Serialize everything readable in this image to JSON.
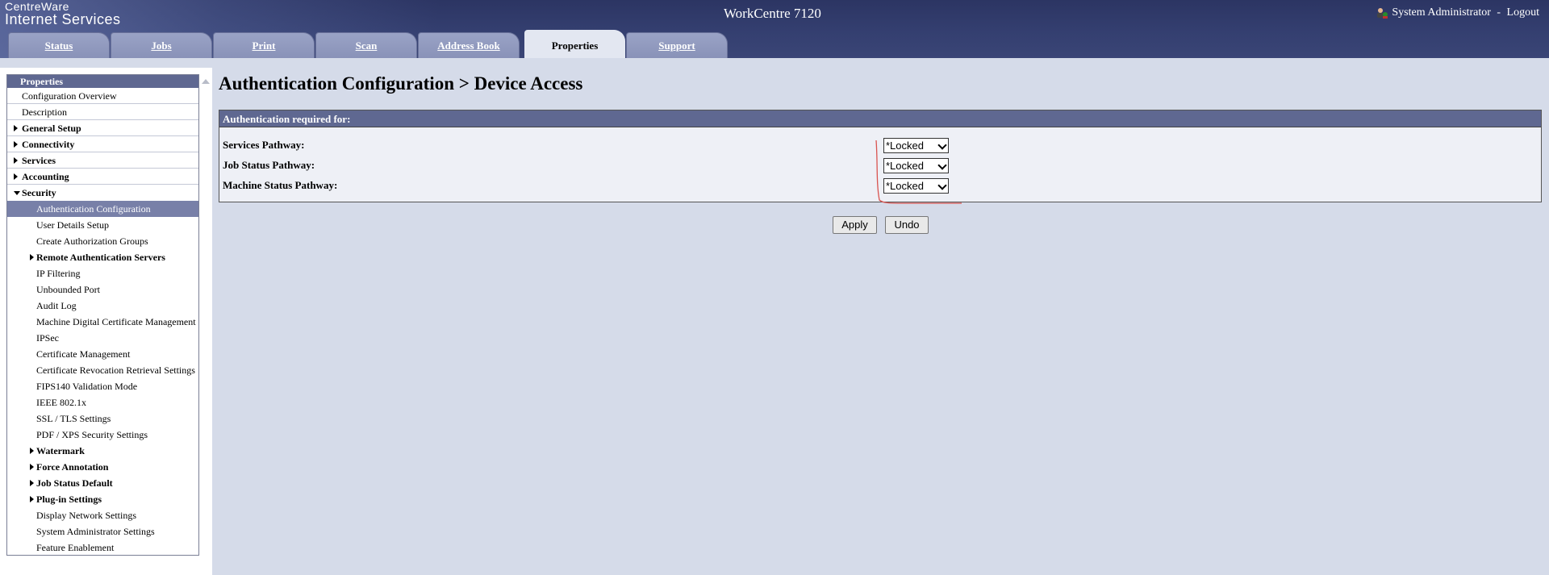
{
  "header": {
    "logo_line1": "CentreWare",
    "logo_line2": "Internet Services",
    "device_name": "WorkCentre 7120",
    "user_name": "System Administrator",
    "separator": " - ",
    "logout": "Logout"
  },
  "tabs": [
    {
      "label": "Status",
      "active": false
    },
    {
      "label": "Jobs",
      "active": false
    },
    {
      "label": "Print",
      "active": false
    },
    {
      "label": "Scan",
      "active": false
    },
    {
      "label": "Address Book",
      "active": false
    },
    {
      "label": "Properties",
      "active": true
    },
    {
      "label": "Support",
      "active": false
    }
  ],
  "sidebar": {
    "header": "Properties",
    "items": [
      {
        "label": "Configuration Overview"
      },
      {
        "label": "Description"
      },
      {
        "label": "General Setup"
      },
      {
        "label": "Connectivity"
      },
      {
        "label": "Services"
      },
      {
        "label": "Accounting"
      },
      {
        "label": "Security"
      },
      {
        "label": "Authentication Configuration"
      },
      {
        "label": "User Details Setup"
      },
      {
        "label": "Create Authorization Groups"
      },
      {
        "label": "Remote Authentication Servers"
      },
      {
        "label": "IP Filtering"
      },
      {
        "label": "Unbounded Port"
      },
      {
        "label": "Audit Log"
      },
      {
        "label": "Machine Digital Certificate Management"
      },
      {
        "label": "IPSec"
      },
      {
        "label": "Certificate Management"
      },
      {
        "label": "Certificate Revocation Retrieval Settings"
      },
      {
        "label": "FIPS140 Validation Mode"
      },
      {
        "label": "IEEE 802.1x"
      },
      {
        "label": "SSL / TLS Settings"
      },
      {
        "label": "PDF / XPS Security Settings"
      },
      {
        "label": "Watermark"
      },
      {
        "label": "Force Annotation"
      },
      {
        "label": "Job Status Default"
      },
      {
        "label": "Plug-in Settings"
      },
      {
        "label": "Display Network Settings"
      },
      {
        "label": "System Administrator Settings"
      },
      {
        "label": "Feature Enablement"
      }
    ]
  },
  "main": {
    "title": "Authentication Configuration > Device Access",
    "panel_header": "Authentication required for:",
    "rows": [
      {
        "label": "Services Pathway:",
        "value": "*Locked"
      },
      {
        "label": "Job Status Pathway:",
        "value": "*Locked"
      },
      {
        "label": "Machine Status Pathway:",
        "value": "*Locked"
      }
    ],
    "apply_label": "Apply",
    "undo_label": "Undo"
  },
  "colors": {
    "header_bg": "#2c3563",
    "panel_header_bg": "#5f6891",
    "page_bg": "#d5dbe9",
    "annotation": "#d9534f"
  }
}
